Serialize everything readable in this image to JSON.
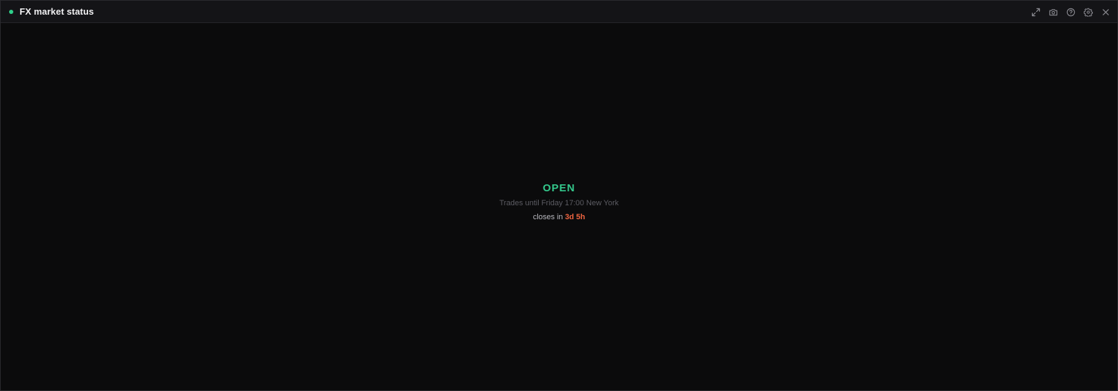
{
  "window": {
    "title": "FX market status",
    "status_dot_color": "#2fd08a",
    "icons": [
      "expand-icon",
      "camera-icon",
      "help-icon",
      "settings-icon",
      "close-icon"
    ]
  },
  "market": {
    "state": "OPEN",
    "state_color": "#34c98c",
    "hours_text": "Trades until Friday 17:00 New York",
    "countdown_label": "closes in",
    "countdown_value": "3d 5h",
    "countdown_color": "#ee6440"
  }
}
